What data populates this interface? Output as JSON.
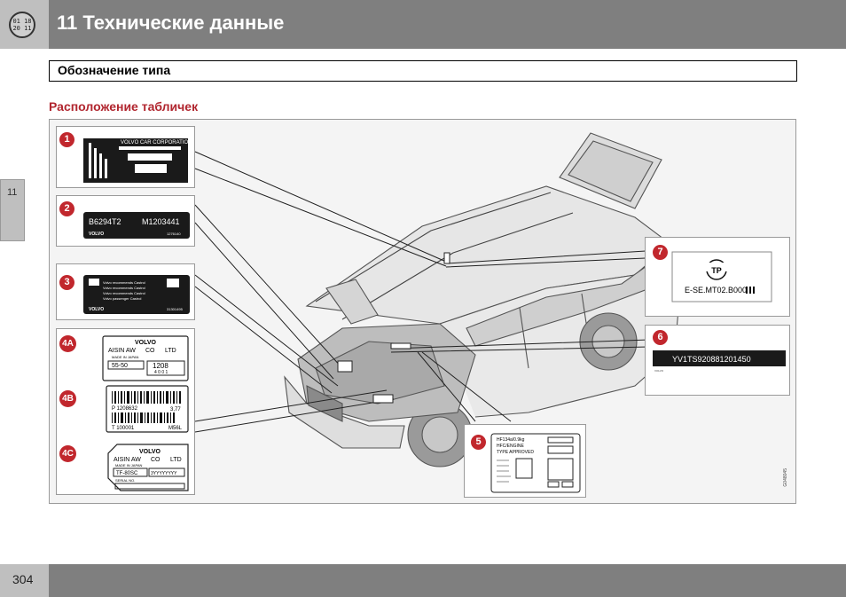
{
  "header": {
    "logo_lines": [
      "01 18",
      "20 11"
    ],
    "title": "11 Технические данные"
  },
  "section": {
    "title": "Обозначение типа"
  },
  "subheading": "Расположение табличек",
  "side_tab": {
    "label": "11"
  },
  "footer": {
    "page_number": "304"
  },
  "figure": {
    "image_code": "G048045",
    "callouts": [
      "1",
      "2",
      "3",
      "4A",
      "4B",
      "4C",
      "5",
      "6",
      "7"
    ],
    "plate_1": {
      "text": "VOLVO CAR CORPORATION"
    },
    "plate_2": {
      "left_code": "B6294T2",
      "right_code": "M1203441",
      "brand": "VOLVO",
      "small": "1276140"
    },
    "plate_3": {
      "lines": [
        "Volvo recommends Castrol",
        "Volvo recommends Castrol",
        "Volvo recommends Castrol",
        "Volvo passenger Castrol"
      ],
      "brand": "VOLVO",
      "code": "31301495"
    },
    "plate_4a": {
      "brand": "VOLVO",
      "maker": [
        "AISIN AW",
        "CO",
        "LTD"
      ],
      "made_in": "MADE IN JAPAN",
      "model": "55-50",
      "serial": "1208",
      "sub": "4 0 0 1"
    },
    "plate_4b": {
      "p_code": "P 1208632",
      "ratio": "3,77",
      "t_code": "T 100001",
      "suffix": "M56L"
    },
    "plate_4c": {
      "brand": "VOLVO",
      "maker": [
        "AISIN AW",
        "CO",
        "LTD"
      ],
      "made_in": "MADE IN JAPAN",
      "model": "TF-80SC",
      "code": "3YYYYYYYY",
      "serial_label": "SERIAL NO."
    },
    "plate_5": {
      "lines": [
        "HF134a/0.9kg",
        "HFC/ENGINE",
        "TYPE APPROVED"
      ]
    },
    "plate_6": {
      "vin": "YV1TS920881201450",
      "small": "VOLVO"
    },
    "plate_7": {
      "mark": "ТР",
      "code": "E-SE.MT02.B000"
    }
  }
}
